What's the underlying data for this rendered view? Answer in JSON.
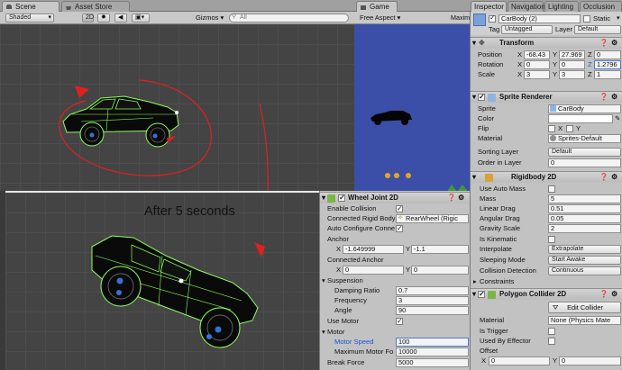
{
  "tabs": {
    "scene": "Scene",
    "asset_store": "Asset Store",
    "game": "Game",
    "inspector": "Inspector",
    "navigation": "Navigation",
    "lighting": "Lighting",
    "occlusion": "Occlusion"
  },
  "scene_toolbar": {
    "shading": "Shaded",
    "mode_2d": "2D",
    "gizmos": "Gizmos",
    "search_placeholder": "All"
  },
  "game_toolbar": {
    "aspect": "Free Aspect",
    "maximize": "Maxim"
  },
  "inspector": {
    "object_name": "CarBody (2)",
    "static_label": "Static",
    "tag_label": "Tag",
    "tag_value": "Untagged",
    "layer_label": "Layer",
    "layer_value": "Default",
    "transform": {
      "title": "Transform",
      "position_label": "Position",
      "rotation_label": "Rotation",
      "scale_label": "Scale",
      "x": "X",
      "y": "Y",
      "z": "Z",
      "position": [
        "-68.43",
        "27.969",
        "0"
      ],
      "rotation": [
        "0",
        "0",
        "1.2796"
      ],
      "scale": [
        "3",
        "3",
        "1"
      ]
    },
    "sprite_renderer": {
      "title": "Sprite Renderer",
      "sprite_label": "Sprite",
      "sprite_value": "CarBody",
      "color_label": "Color",
      "flip_label": "Flip",
      "flip_x": "X",
      "flip_y": "Y",
      "material_label": "Material",
      "material_value": "Sprites-Default",
      "sorting_layer_label": "Sorting Layer",
      "sorting_layer_value": "Default",
      "order_label": "Order in Layer",
      "order_value": "0"
    },
    "rigidbody": {
      "title": "Rigidbody 2D",
      "use_auto_mass": "Use Auto Mass",
      "mass_label": "Mass",
      "mass": "5",
      "linear_drag_label": "Linear Drag",
      "linear_drag": "0.51",
      "angular_drag_label": "Angular Drag",
      "angular_drag": "0.05",
      "gravity_label": "Gravity Scale",
      "gravity": "2",
      "kinematic_label": "Is Kinematic",
      "interpolate_label": "Interpolate",
      "interpolate": "Extrapolate",
      "sleeping_label": "Sleeping Mode",
      "sleeping": "Start Awake",
      "collision_label": "Collision Detection",
      "collision": "Continuous",
      "constraints_label": "Constraints"
    },
    "polygon": {
      "title": "Polygon Collider 2D",
      "edit_button": "Edit Collider",
      "material_label": "Material",
      "material_value": "None (Physics Mate",
      "is_trigger_label": "Is Trigger",
      "used_by_effector_label": "Used By Effector",
      "offset_label": "Offset",
      "x": "X",
      "y": "Y",
      "offset": [
        "0",
        "0"
      ]
    }
  },
  "wheel_joint": {
    "title": "Wheel Joint 2D",
    "enable_collision": "Enable Collision",
    "connected_body_label": "Connected Rigid Body",
    "connected_body_value": "RearWheel (Rigic",
    "auto_configure": "Auto Configure Conne",
    "anchor_label": "Anchor",
    "anchor_x": "-1.649999",
    "anchor_y": "-1.1",
    "connected_anchor_label": "Connected Anchor",
    "connected_anchor_x": "0",
    "connected_anchor_y": "0",
    "x": "X",
    "y": "Y",
    "suspension_label": "Suspension",
    "damping_label": "Damping Ratio",
    "damping": "0.7",
    "frequency_label": "Frequency",
    "frequency": "3",
    "angle_label": "Angle",
    "angle": "90",
    "use_motor_label": "Use Motor",
    "motor_label": "Motor",
    "motor_speed_label": "Motor Speed",
    "motor_speed": "100",
    "max_torque_label": "Maximum Motor Fo",
    "max_torque": "10000",
    "break_force_label": "Break Force",
    "break_force": "5000"
  },
  "annotation": "After 5 seconds",
  "colors": {
    "collider_green": "#8dff5a",
    "arrow_red": "#e02020",
    "game_sky": "#3b4fa8",
    "motor_speed_blue": "#1f55d6"
  }
}
